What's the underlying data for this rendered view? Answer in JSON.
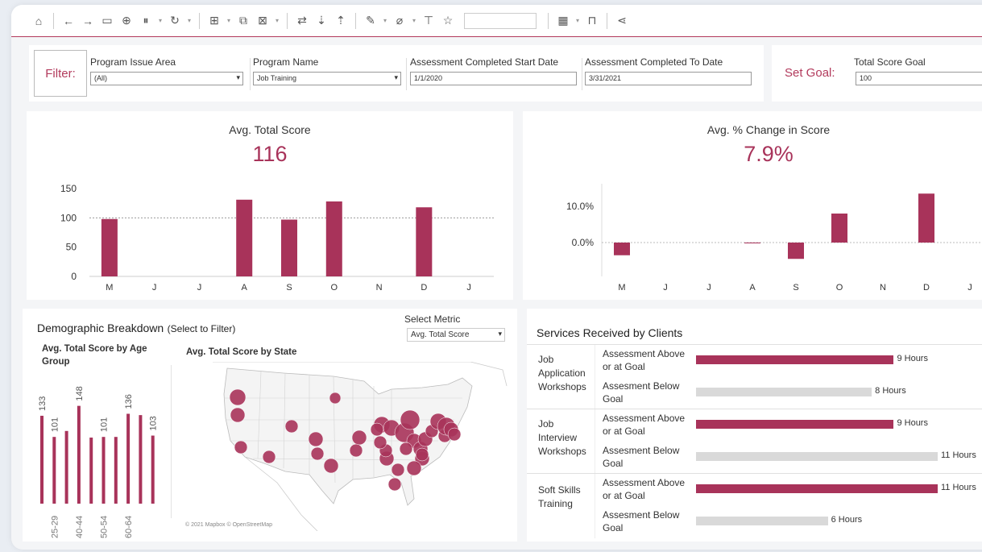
{
  "toolbar": {
    "icons": [
      "home-icon",
      "back-icon",
      "forward-icon",
      "save-icon",
      "new-datasource-icon",
      "pause-icon",
      "refresh-icon",
      "new-worksheet-icon",
      "duplicate-icon",
      "clear-icon",
      "swap-icon",
      "sort-asc-icon",
      "sort-desc-icon",
      "highlight-icon",
      "group-icon",
      "label-icon",
      "pin-icon",
      "fit-select",
      "show-me-icon",
      "presentation-icon",
      "share-icon"
    ]
  },
  "filter": {
    "label": "Filter:",
    "program_issue_area": {
      "label": "Program Issue Area",
      "value": "(All)"
    },
    "program_name": {
      "label": "Program Name",
      "value": "Job Training"
    },
    "start_date": {
      "label": "Assessment Completed Start Date",
      "value": "1/1/2020"
    },
    "end_date": {
      "label": "Assessment Completed To Date",
      "value": "3/31/2021"
    }
  },
  "goal": {
    "label": "Set Goal:",
    "total_score_goal": {
      "label": "Total Score Goal",
      "value": "100"
    }
  },
  "avg_total_score": {
    "title": "Avg. Total Score",
    "value": "116",
    "chart_data": {
      "type": "bar",
      "categories": [
        "M",
        "J",
        "J",
        "A",
        "S",
        "O",
        "N",
        "D",
        "J"
      ],
      "values": [
        98,
        null,
        null,
        131,
        97,
        128,
        null,
        118,
        null
      ],
      "yticks": [
        "150",
        "100",
        "50",
        "0"
      ],
      "ylim": [
        0,
        150
      ],
      "reference_line": 100,
      "color": "#a8335a"
    }
  },
  "avg_pct_change": {
    "title": "Avg. % Change in Score",
    "value": "7.9%",
    "chart_data": {
      "type": "bar",
      "categories": [
        "M",
        "J",
        "J",
        "A",
        "S",
        "O",
        "N",
        "D",
        "J"
      ],
      "values": [
        -3.5,
        null,
        null,
        -0.2,
        -4.5,
        8.0,
        null,
        13.5,
        null
      ],
      "yticks": [
        "10.0%",
        "0.0%"
      ],
      "color": "#a8335a"
    }
  },
  "demographic": {
    "title": "Demographic Breakdown",
    "subtitle": "(Select to Filter)",
    "select_metric_label": "Select Metric",
    "select_metric_value": "Avg. Total Score",
    "age_chart": {
      "title": "Avg. Total Score by Age Group",
      "chart_data": {
        "type": "bar",
        "categories": [
          "",
          "25-29",
          "",
          "40-44",
          "",
          "50-54",
          "",
          "60-64",
          ""
        ],
        "values": [
          133,
          101,
          110,
          148,
          100,
          101,
          101,
          136,
          134,
          103
        ],
        "value_labels": [
          "133",
          "101",
          "",
          "148",
          "",
          "101",
          "",
          "136",
          "",
          "103"
        ],
        "tick_labels": [
          "25-29",
          "40-44",
          "50-54",
          "60-64"
        ]
      }
    },
    "state_map": {
      "title": "Avg. Total Score by State",
      "attribution": "© 2021 Mapbox © OpenStreetMap",
      "color": "#a8335a"
    }
  },
  "services": {
    "title": "Services Received by Clients",
    "chart_data": {
      "type": "bar",
      "max": 11,
      "groups": [
        {
          "name": "Job Application Workshops",
          "rows": [
            {
              "label": "Assessment Above or at Goal",
              "value": 9,
              "value_label": "9 Hours",
              "color": "#a8335a"
            },
            {
              "label": "Assesment Below Goal",
              "value": 8,
              "value_label": "8 Hours",
              "color": "#d9d9d9"
            }
          ]
        },
        {
          "name": "Job Interview Workshops",
          "rows": [
            {
              "label": "Assessment Above or at Goal",
              "value": 9,
              "value_label": "9 Hours",
              "color": "#a8335a"
            },
            {
              "label": "Assesment Below Goal",
              "value": 11,
              "value_label": "11 Hours",
              "color": "#d9d9d9"
            }
          ]
        },
        {
          "name": "Soft Skills Training",
          "rows": [
            {
              "label": "Assessment Above or at Goal",
              "value": 11,
              "value_label": "11 Hours",
              "color": "#a8335a"
            },
            {
              "label": "Assesment Below Goal",
              "value": 6,
              "value_label": "6 Hours",
              "color": "#d9d9d9"
            }
          ]
        }
      ]
    }
  }
}
